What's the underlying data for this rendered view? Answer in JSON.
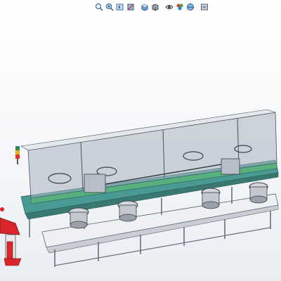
{
  "view_toolbar": {
    "items": [
      {
        "icon": "zoom-to-fit-icon"
      },
      {
        "icon": "zoom-to-area-icon"
      },
      {
        "icon": "previous-view-icon"
      },
      {
        "icon": "section-view-icon"
      },
      {
        "icon": "view-orientation-icon"
      },
      {
        "icon": "display-style-icon"
      },
      {
        "icon": "hide-show-items-icon"
      },
      {
        "icon": "edit-appearance-icon"
      },
      {
        "icon": "apply-scene-icon"
      },
      {
        "icon": "view-settings-icon"
      }
    ]
  },
  "model": {
    "frame_color": "#b9bfc8",
    "panel_color": "#9aa6b4",
    "machine_base_color": "#3f8f8a",
    "feeder_color": "#c8ccd2",
    "red_part_color": "#d9262c"
  }
}
